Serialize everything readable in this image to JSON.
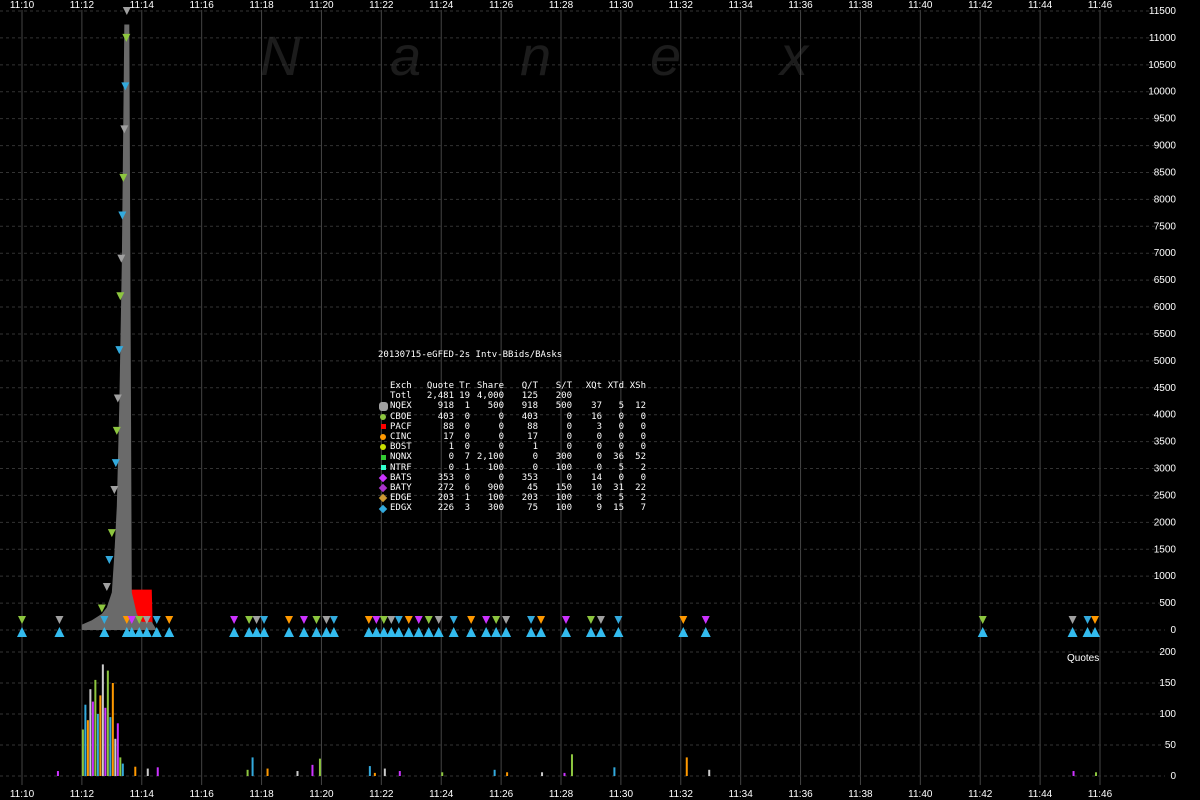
{
  "chart_data": {
    "type": "bar",
    "watermark": "N a n e x",
    "title": "20130715-eGFED-2s Intv-BBids/BAsks",
    "x_tick_labels": [
      "11:10",
      "11:12",
      "11:14",
      "11:16",
      "11:18",
      "11:20",
      "11:22",
      "11:24",
      "11:26",
      "11:28",
      "11:30",
      "11:32",
      "11:34",
      "11:36",
      "11:38",
      "11:40",
      "11:42",
      "11:44",
      "11:46"
    ],
    "top_panel": {
      "ylim": [
        0,
        11500
      ],
      "y_ticks": [
        0,
        500,
        1000,
        1500,
        2000,
        2500,
        3000,
        3500,
        4000,
        4500,
        5000,
        5500,
        6000,
        6500,
        7000,
        7500,
        8000,
        8500,
        9000,
        9500,
        10000,
        10500,
        11000,
        11500
      ],
      "gray_area": {
        "x": [
          "11:12:00",
          "11:12:20",
          "11:12:40",
          "11:12:50",
          "11:13:00",
          "11:13:05",
          "11:13:10",
          "11:13:15",
          "11:13:20",
          "11:13:25",
          "11:13:30",
          "11:13:35",
          "11:13:40",
          "11:13:50",
          "11:14:00",
          "11:14:20",
          "11:14:30"
        ],
        "y": [
          100,
          180,
          300,
          420,
          700,
          1400,
          2300,
          4200,
          6800,
          11250,
          11250,
          11250,
          700,
          300,
          150,
          150,
          0
        ]
      },
      "red_area": {
        "x": [
          "11:13:30",
          "11:13:40",
          "11:14:00",
          "11:14:20",
          "11:14:22"
        ],
        "y": [
          750,
          750,
          750,
          750,
          0
        ]
      },
      "spike_markers": {
        "x": [
          "11:12:40",
          "11:12:50",
          "11:12:55",
          "11:13:00",
          "11:13:05",
          "11:13:08",
          "11:13:10",
          "11:13:12",
          "11:13:15",
          "11:13:17",
          "11:13:19",
          "11:13:21",
          "11:13:23",
          "11:13:25",
          "11:13:27",
          "11:13:29",
          "11:13:30"
        ],
        "y": [
          400,
          800,
          1300,
          1800,
          2600,
          3100,
          3700,
          4300,
          5200,
          6200,
          6900,
          7700,
          8400,
          9300,
          10100,
          11000,
          11500
        ]
      },
      "zero_row_times": [
        "11:10:00",
        "11:11:15",
        "11:12:45",
        "11:13:30",
        "11:13:40",
        "11:13:55",
        "11:14:10",
        "11:14:30",
        "11:14:55",
        "11:17:05",
        "11:17:35",
        "11:17:50",
        "11:18:05",
        "11:18:55",
        "11:19:25",
        "11:19:50",
        "11:20:10",
        "11:20:25",
        "11:21:35",
        "11:21:50",
        "11:22:05",
        "11:22:20",
        "11:22:35",
        "11:22:55",
        "11:23:15",
        "11:23:35",
        "11:23:55",
        "11:24:25",
        "11:25:00",
        "11:25:30",
        "11:25:50",
        "11:26:10",
        "11:27:00",
        "11:27:20",
        "11:28:10",
        "11:29:00",
        "11:29:20",
        "11:29:55",
        "11:32:05",
        "11:32:50",
        "11:42:05",
        "11:45:05",
        "11:45:35",
        "11:45:50"
      ]
    },
    "bottom_panel": {
      "ylim": [
        0,
        200
      ],
      "y_ticks": [
        0,
        50,
        100,
        150,
        200
      ],
      "label": "Quotes",
      "bars": {
        "x": [
          "11:11:10",
          "11:12:00",
          "11:12:05",
          "11:12:10",
          "11:12:15",
          "11:12:20",
          "11:12:25",
          "11:12:30",
          "11:12:35",
          "11:12:40",
          "11:12:45",
          "11:12:50",
          "11:12:55",
          "11:13:00",
          "11:13:05",
          "11:13:10",
          "11:13:15",
          "11:13:20",
          "11:13:45",
          "11:14:10",
          "11:14:30",
          "11:17:30",
          "11:17:40",
          "11:18:10",
          "11:19:10",
          "11:19:40",
          "11:19:55",
          "11:21:35",
          "11:21:45",
          "11:22:05",
          "11:22:35",
          "11:24:00",
          "11:25:45",
          "11:26:10",
          "11:27:20",
          "11:28:05",
          "11:28:20",
          "11:29:45",
          "11:32:10",
          "11:32:55",
          "11:45:05",
          "11:45:50"
        ],
        "y": [
          8,
          75,
          115,
          90,
          140,
          120,
          155,
          100,
          130,
          180,
          110,
          170,
          95,
          150,
          60,
          85,
          30,
          20,
          15,
          12,
          14,
          10,
          30,
          12,
          8,
          18,
          28,
          16,
          5,
          12,
          8,
          6,
          10,
          6,
          6,
          5,
          35,
          14,
          30,
          10,
          8,
          6
        ]
      }
    },
    "legend": {
      "header": [
        "Exch",
        "Quote",
        "Tr",
        "Share",
        "Q/T",
        "S/T",
        "XQt",
        "XTd",
        "XSh"
      ],
      "total": [
        "Totl",
        "2,481",
        "19",
        "4,000",
        "125",
        "200",
        "",
        "",
        ""
      ],
      "rows": [
        {
          "shape": "octagon",
          "color": "#a0a0a0",
          "cells": [
            "NQEX",
            "918",
            "1",
            "500",
            "918",
            "500",
            "37",
            "5",
            "12"
          ]
        },
        {
          "shape": "circle",
          "color": "#8dc63f",
          "cells": [
            "CBOE",
            "403",
            "0",
            "0",
            "403",
            "0",
            "16",
            "0",
            "0"
          ]
        },
        {
          "shape": "square",
          "color": "#ff0000",
          "cells": [
            "PACF",
            "88",
            "0",
            "0",
            "88",
            "0",
            "3",
            "0",
            "0"
          ]
        },
        {
          "shape": "circle",
          "color": "#ff9900",
          "cells": [
            "CINC",
            "17",
            "0",
            "0",
            "17",
            "0",
            "0",
            "0",
            "0"
          ]
        },
        {
          "shape": "circle",
          "color": "#c8e000",
          "cells": [
            "BOST",
            "1",
            "0",
            "0",
            "1",
            "0",
            "0",
            "0",
            "0"
          ]
        },
        {
          "shape": "square",
          "color": "#33cc33",
          "cells": [
            "NQNX",
            "0",
            "7",
            "2,100",
            "0",
            "300",
            "0",
            "36",
            "52"
          ]
        },
        {
          "shape": "square",
          "color": "#33ffcc",
          "cells": [
            "NTRF",
            "0",
            "1",
            "100",
            "0",
            "100",
            "0",
            "5",
            "2"
          ]
        },
        {
          "shape": "diamond",
          "color": "#cc33ff",
          "cells": [
            "BATS",
            "353",
            "0",
            "0",
            "353",
            "0",
            "14",
            "0",
            "0"
          ]
        },
        {
          "shape": "diamond",
          "color": "#aa33cc",
          "cells": [
            "BATY",
            "272",
            "6",
            "900",
            "45",
            "150",
            "10",
            "31",
            "22"
          ]
        },
        {
          "shape": "diamond",
          "color": "#cc9933",
          "cells": [
            "EDGE",
            "203",
            "1",
            "100",
            "203",
            "100",
            "8",
            "5",
            "2"
          ]
        },
        {
          "shape": "diamond",
          "color": "#33aadd",
          "cells": [
            "EDGX",
            "226",
            "3",
            "300",
            "75",
            "100",
            "9",
            "15",
            "7"
          ]
        }
      ]
    }
  }
}
